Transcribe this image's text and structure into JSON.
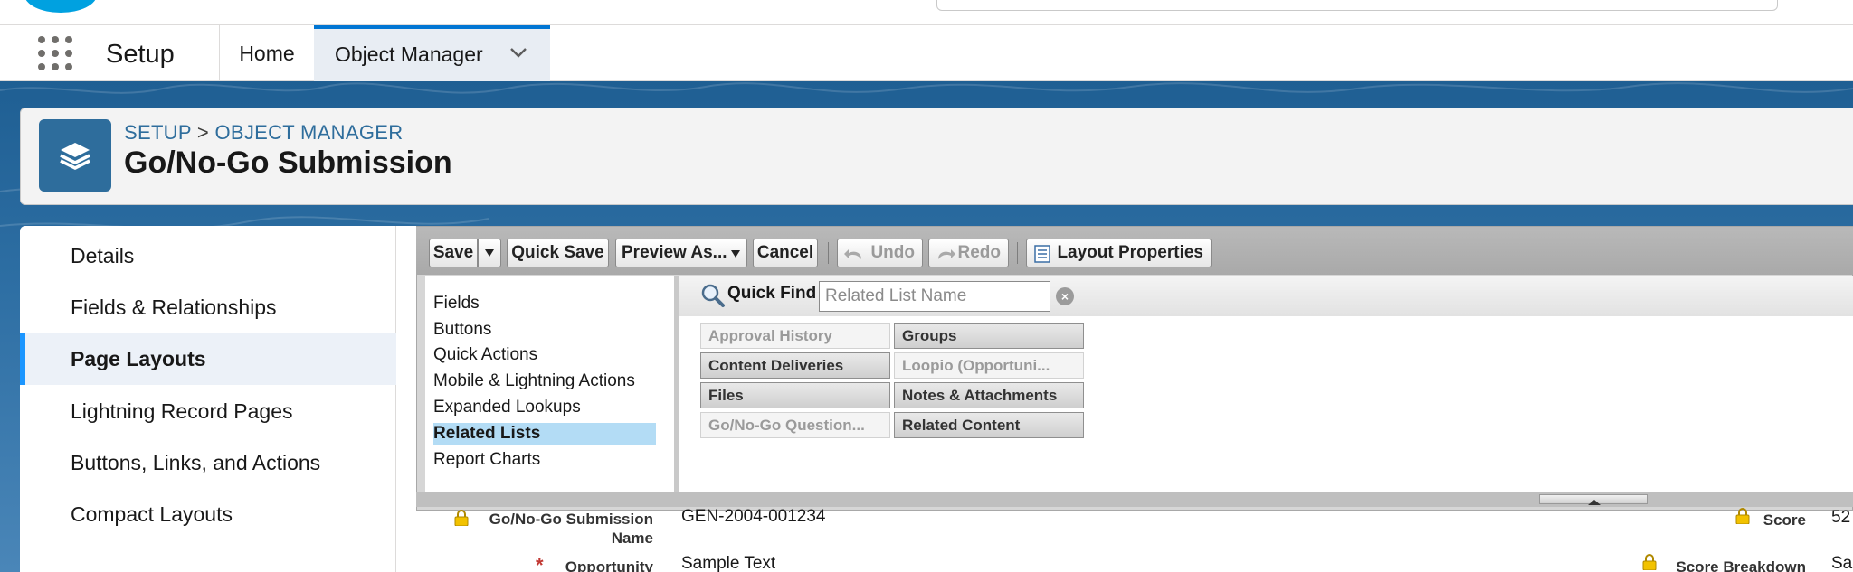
{
  "nav": {
    "app_name": "Setup",
    "tabs": [
      {
        "label": "Home"
      },
      {
        "label": "Object Manager"
      }
    ]
  },
  "header": {
    "breadcrumb_setup": "SETUP",
    "breadcrumb_sep": ">",
    "breadcrumb_object_manager": "OBJECT MANAGER",
    "title": "Go/No-Go Submission"
  },
  "sidebar": {
    "items": [
      {
        "label": "Details"
      },
      {
        "label": "Fields & Relationships"
      },
      {
        "label": "Page Layouts"
      },
      {
        "label": "Lightning Record Pages"
      },
      {
        "label": "Buttons, Links, and Actions"
      },
      {
        "label": "Compact Layouts"
      }
    ],
    "active": "Page Layouts"
  },
  "toolbar": {
    "save": "Save",
    "quick_save": "Quick Save",
    "preview_as": "Preview As...",
    "cancel": "Cancel",
    "undo": "Undo",
    "redo": "Redo",
    "layout_properties": "Layout Properties"
  },
  "palette": {
    "categories": [
      {
        "label": "Fields"
      },
      {
        "label": "Buttons"
      },
      {
        "label": "Quick Actions"
      },
      {
        "label": "Mobile & Lightning Actions"
      },
      {
        "label": "Expanded Lookups"
      },
      {
        "label": "Related Lists"
      },
      {
        "label": "Report Charts"
      }
    ],
    "selected_category": "Related Lists",
    "quick_find_label": "Quick Find",
    "quick_find_placeholder": "Related List Name",
    "related_lists": [
      {
        "label": "Approval History",
        "enabled": false
      },
      {
        "label": "Groups",
        "enabled": true
      },
      {
        "label": "Content Deliveries",
        "enabled": true
      },
      {
        "label": "Loopio (Opportuni...",
        "enabled": false
      },
      {
        "label": "Files",
        "enabled": true
      },
      {
        "label": "Notes & Attachments",
        "enabled": true
      },
      {
        "label": "Go/No-Go Question...",
        "enabled": false
      },
      {
        "label": "Related Content",
        "enabled": true
      }
    ]
  },
  "record": {
    "name_label_line1": "Go/No-Go Submission",
    "name_label_line2": "Name",
    "name_value": "GEN-2004-001234",
    "opportunity_label": "Opportunity",
    "opportunity_value": "Sample Text",
    "score_label": "Score",
    "score_value": "52",
    "score_breakdown_label": "Score Breakdown",
    "score_breakdown_value": "Sa"
  },
  "colors": {
    "brand_blue": "#0176d3",
    "object_icon": "#2e6d9c",
    "active_nav_bg": "#ecf1f8",
    "selected_category_bg": "#b3dcf5",
    "required": "#c23934"
  }
}
